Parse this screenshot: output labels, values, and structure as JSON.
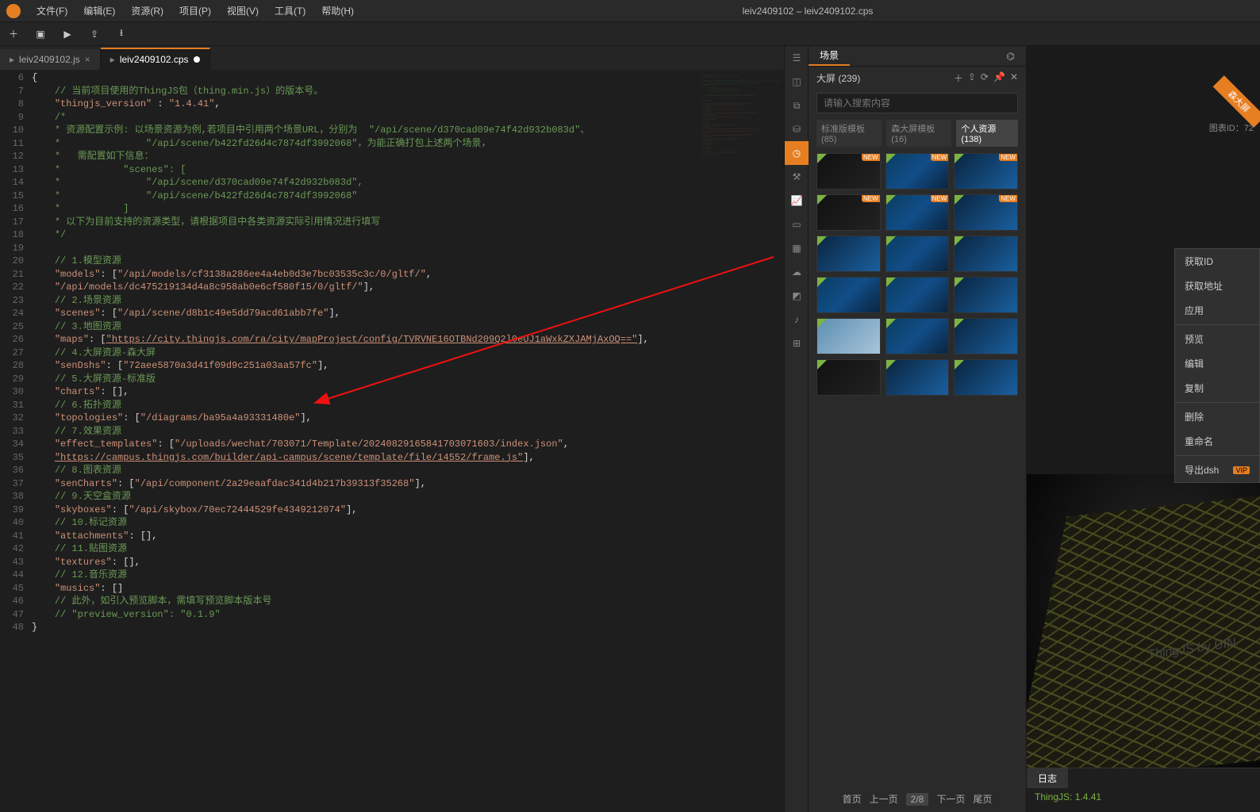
{
  "menubar": {
    "items": [
      "文件(F)",
      "编辑(E)",
      "资源(R)",
      "项目(P)",
      "视图(V)",
      "工具(T)",
      "帮助(H)"
    ],
    "title": "leiv2409102 – leiv2409102.cps"
  },
  "tabs": [
    {
      "label": "leiv2409102.js",
      "active": false
    },
    {
      "label": "leiv2409102.cps",
      "active": true
    }
  ],
  "code_lines": [
    {
      "n": 6,
      "segs": [
        {
          "t": "{",
          "c": "p"
        }
      ]
    },
    {
      "n": 7,
      "segs": [
        {
          "t": "    ",
          "c": "p"
        },
        {
          "t": "// 当前项目使用的ThingJS包（thing.min.js）的版本号。",
          "c": "c"
        }
      ]
    },
    {
      "n": 8,
      "segs": [
        {
          "t": "    ",
          "c": "p"
        },
        {
          "t": "\"thingjs_version\"",
          "c": "s"
        },
        {
          "t": " : ",
          "c": "p"
        },
        {
          "t": "\"1.4.41\"",
          "c": "s"
        },
        {
          "t": ",",
          "c": "p"
        }
      ]
    },
    {
      "n": 9,
      "segs": [
        {
          "t": "    ",
          "c": "p"
        },
        {
          "t": "/*",
          "c": "c"
        }
      ]
    },
    {
      "n": 10,
      "segs": [
        {
          "t": "    ",
          "c": "p"
        },
        {
          "t": "* 资源配置示例: 以场景资源为例,若项目中引用两个场景URL，分别为  \"/api/scene/d370cad09e74f42d932b083d\"、",
          "c": "c"
        }
      ]
    },
    {
      "n": 11,
      "segs": [
        {
          "t": "    ",
          "c": "p"
        },
        {
          "t": "*               \"/api/scene/b422fd26d4c7874df3992068\"，为能正确打包上述两个场景，",
          "c": "c"
        }
      ]
    },
    {
      "n": 12,
      "segs": [
        {
          "t": "    ",
          "c": "p"
        },
        {
          "t": "*   需配置如下信息：",
          "c": "c"
        }
      ]
    },
    {
      "n": 13,
      "segs": [
        {
          "t": "    ",
          "c": "p"
        },
        {
          "t": "*           \"scenes\": [",
          "c": "c"
        }
      ]
    },
    {
      "n": 14,
      "segs": [
        {
          "t": "    ",
          "c": "p"
        },
        {
          "t": "*               \"/api/scene/d370cad09e74f42d932b083d\",",
          "c": "c"
        }
      ]
    },
    {
      "n": 15,
      "segs": [
        {
          "t": "    ",
          "c": "p"
        },
        {
          "t": "*               \"/api/scene/b422fd26d4c7874df3992068\"",
          "c": "c"
        }
      ]
    },
    {
      "n": 16,
      "segs": [
        {
          "t": "    ",
          "c": "p"
        },
        {
          "t": "*           ]",
          "c": "c"
        }
      ]
    },
    {
      "n": 17,
      "segs": [
        {
          "t": "    ",
          "c": "p"
        },
        {
          "t": "* 以下为目前支持的资源类型，请根据项目中各类资源实际引用情况进行填写",
          "c": "c"
        }
      ]
    },
    {
      "n": 18,
      "segs": [
        {
          "t": "    ",
          "c": "p"
        },
        {
          "t": "*/",
          "c": "c"
        }
      ]
    },
    {
      "n": 19,
      "segs": [
        {
          "t": " ",
          "c": "p"
        }
      ]
    },
    {
      "n": 20,
      "segs": [
        {
          "t": "    ",
          "c": "p"
        },
        {
          "t": "// 1.模型资源",
          "c": "c"
        }
      ]
    },
    {
      "n": 21,
      "segs": [
        {
          "t": "    ",
          "c": "p"
        },
        {
          "t": "\"models\"",
          "c": "s"
        },
        {
          "t": ": [",
          "c": "p"
        },
        {
          "t": "\"/api/models/cf3138a286ee4a4eb0d3e7bc03535c3c/0/gltf/\"",
          "c": "s"
        },
        {
          "t": ",",
          "c": "p"
        }
      ]
    },
    {
      "n": 22,
      "segs": [
        {
          "t": "    ",
          "c": "p"
        },
        {
          "t": "\"/api/models/dc475219134d4a8c958ab0e6cf580f15/0/gltf/\"",
          "c": "s"
        },
        {
          "t": "],",
          "c": "p"
        }
      ]
    },
    {
      "n": 23,
      "segs": [
        {
          "t": "    ",
          "c": "p"
        },
        {
          "t": "// 2.场景资源",
          "c": "c"
        }
      ]
    },
    {
      "n": 24,
      "segs": [
        {
          "t": "    ",
          "c": "p"
        },
        {
          "t": "\"scenes\"",
          "c": "s"
        },
        {
          "t": ": [",
          "c": "p"
        },
        {
          "t": "\"/api/scene/d8b1c49e5dd79acd61abb7fe\"",
          "c": "s"
        },
        {
          "t": "],",
          "c": "p"
        }
      ]
    },
    {
      "n": 25,
      "segs": [
        {
          "t": "    ",
          "c": "p"
        },
        {
          "t": "// 3.地图资源",
          "c": "c"
        }
      ]
    },
    {
      "n": 26,
      "segs": [
        {
          "t": "    ",
          "c": "p"
        },
        {
          "t": "\"maps\"",
          "c": "s"
        },
        {
          "t": ": [",
          "c": "p"
        },
        {
          "t": "\"https://city.thingjs.com/ra/city/mapProject/config/TVRVNE16OTBNd209Q2l0eUJ1aWxkZXJAMjAxOQ==\"",
          "c": "s u"
        },
        {
          "t": "],",
          "c": "p"
        }
      ]
    },
    {
      "n": 27,
      "segs": [
        {
          "t": "    ",
          "c": "p"
        },
        {
          "t": "// 4.大屏资源-森大屏",
          "c": "c"
        }
      ]
    },
    {
      "n": 28,
      "segs": [
        {
          "t": "    ",
          "c": "p"
        },
        {
          "t": "\"senDshs\"",
          "c": "s"
        },
        {
          "t": ": [",
          "c": "p"
        },
        {
          "t": "\"72aee5870a3d41f09d9c251a03aa57fc\"",
          "c": "s"
        },
        {
          "t": "],",
          "c": "p"
        }
      ]
    },
    {
      "n": 29,
      "segs": [
        {
          "t": "    ",
          "c": "p"
        },
        {
          "t": "// 5.大屏资源-标准版",
          "c": "c"
        }
      ]
    },
    {
      "n": 30,
      "segs": [
        {
          "t": "    ",
          "c": "p"
        },
        {
          "t": "\"charts\"",
          "c": "s"
        },
        {
          "t": ": [],",
          "c": "p"
        }
      ]
    },
    {
      "n": 31,
      "segs": [
        {
          "t": "    ",
          "c": "p"
        },
        {
          "t": "// 6.拓扑资源",
          "c": "c"
        }
      ]
    },
    {
      "n": 32,
      "segs": [
        {
          "t": "    ",
          "c": "p"
        },
        {
          "t": "\"topologies\"",
          "c": "s"
        },
        {
          "t": ": [",
          "c": "p"
        },
        {
          "t": "\"/diagrams/ba95a4a93331480e\"",
          "c": "s"
        },
        {
          "t": "],",
          "c": "p"
        }
      ]
    },
    {
      "n": 33,
      "segs": [
        {
          "t": "    ",
          "c": "p"
        },
        {
          "t": "// 7.效果资源",
          "c": "c"
        }
      ]
    },
    {
      "n": 34,
      "segs": [
        {
          "t": "    ",
          "c": "p"
        },
        {
          "t": "\"effect_templates\"",
          "c": "s"
        },
        {
          "t": ": [",
          "c": "p"
        },
        {
          "t": "\"/uploads/wechat/703071/Template/20240829165841703071603/index.json\"",
          "c": "s"
        },
        {
          "t": ",",
          "c": "p"
        }
      ]
    },
    {
      "n": 35,
      "segs": [
        {
          "t": "    ",
          "c": "p"
        },
        {
          "t": "\"https://campus.thingjs.com/builder/api-campus/scene/template/file/14552/frame.js\"",
          "c": "s u"
        },
        {
          "t": "],",
          "c": "p"
        }
      ]
    },
    {
      "n": 36,
      "segs": [
        {
          "t": "    ",
          "c": "p"
        },
        {
          "t": "// 8.图表资源",
          "c": "c"
        }
      ]
    },
    {
      "n": 37,
      "segs": [
        {
          "t": "    ",
          "c": "p"
        },
        {
          "t": "\"senCharts\"",
          "c": "s"
        },
        {
          "t": ": [",
          "c": "p"
        },
        {
          "t": "\"/api/component/2a29eaafdac341d4b217b39313f35268\"",
          "c": "s"
        },
        {
          "t": "],",
          "c": "p"
        }
      ]
    },
    {
      "n": 38,
      "segs": [
        {
          "t": "    ",
          "c": "p"
        },
        {
          "t": "// 9.天空盒资源",
          "c": "c"
        }
      ]
    },
    {
      "n": 39,
      "segs": [
        {
          "t": "    ",
          "c": "p"
        },
        {
          "t": "\"skyboxes\"",
          "c": "s"
        },
        {
          "t": ": [",
          "c": "p"
        },
        {
          "t": "\"/api/skybox/70ec72444529fe4349212074\"",
          "c": "s"
        },
        {
          "t": "],",
          "c": "p"
        }
      ]
    },
    {
      "n": 40,
      "segs": [
        {
          "t": "    ",
          "c": "p"
        },
        {
          "t": "// 10.标记资源",
          "c": "c"
        }
      ]
    },
    {
      "n": 41,
      "segs": [
        {
          "t": "    ",
          "c": "p"
        },
        {
          "t": "\"attachments\"",
          "c": "s"
        },
        {
          "t": ": [],",
          "c": "p"
        }
      ]
    },
    {
      "n": 42,
      "segs": [
        {
          "t": "    ",
          "c": "p"
        },
        {
          "t": "// 11.贴图资源",
          "c": "c"
        }
      ]
    },
    {
      "n": 43,
      "segs": [
        {
          "t": "    ",
          "c": "p"
        },
        {
          "t": "\"textures\"",
          "c": "s"
        },
        {
          "t": ": [],",
          "c": "p"
        }
      ]
    },
    {
      "n": 44,
      "segs": [
        {
          "t": "    ",
          "c": "p"
        },
        {
          "t": "// 12.音乐资源",
          "c": "c"
        }
      ]
    },
    {
      "n": 45,
      "segs": [
        {
          "t": "    ",
          "c": "p"
        },
        {
          "t": "\"musics\"",
          "c": "s"
        },
        {
          "t": ": []",
          "c": "p"
        }
      ]
    },
    {
      "n": 46,
      "segs": [
        {
          "t": "    ",
          "c": "p"
        },
        {
          "t": "// 此外，如引入预览脚本，需填写预览脚本版本号",
          "c": "c"
        }
      ]
    },
    {
      "n": 47,
      "segs": [
        {
          "t": "    ",
          "c": "p"
        },
        {
          "t": "// \"preview_version\": \"0.1.9\"",
          "c": "c"
        }
      ]
    },
    {
      "n": 48,
      "segs": [
        {
          "t": "}",
          "c": "p"
        }
      ]
    }
  ],
  "scene": {
    "header_tabs": [
      "场景",
      ""
    ],
    "title": "大屏  (239)",
    "search_placeholder": "请输入搜索内容",
    "filter_tabs": [
      {
        "label": "标准版模板(85)",
        "active": false
      },
      {
        "label": "森大屏模板(16)",
        "active": false
      },
      {
        "label": "个人资源(138)",
        "active": true
      }
    ],
    "pager": {
      "first": "首页",
      "prev": "上一页",
      "num": "2/8",
      "next": "下一页",
      "last": "尾页"
    }
  },
  "context_menu": {
    "items": [
      "获取ID",
      "获取地址",
      "应用",
      "预览",
      "编辑",
      "复制",
      "删除",
      "重命名",
      "导出dsh"
    ],
    "vip": "VIP"
  },
  "preview": {
    "tag": "森大屏",
    "meta": "图表ID：72",
    "watermark": "ThingJS by UIN"
  },
  "log": {
    "tab": "日志",
    "line": "ThingJS: 1.4.41"
  }
}
